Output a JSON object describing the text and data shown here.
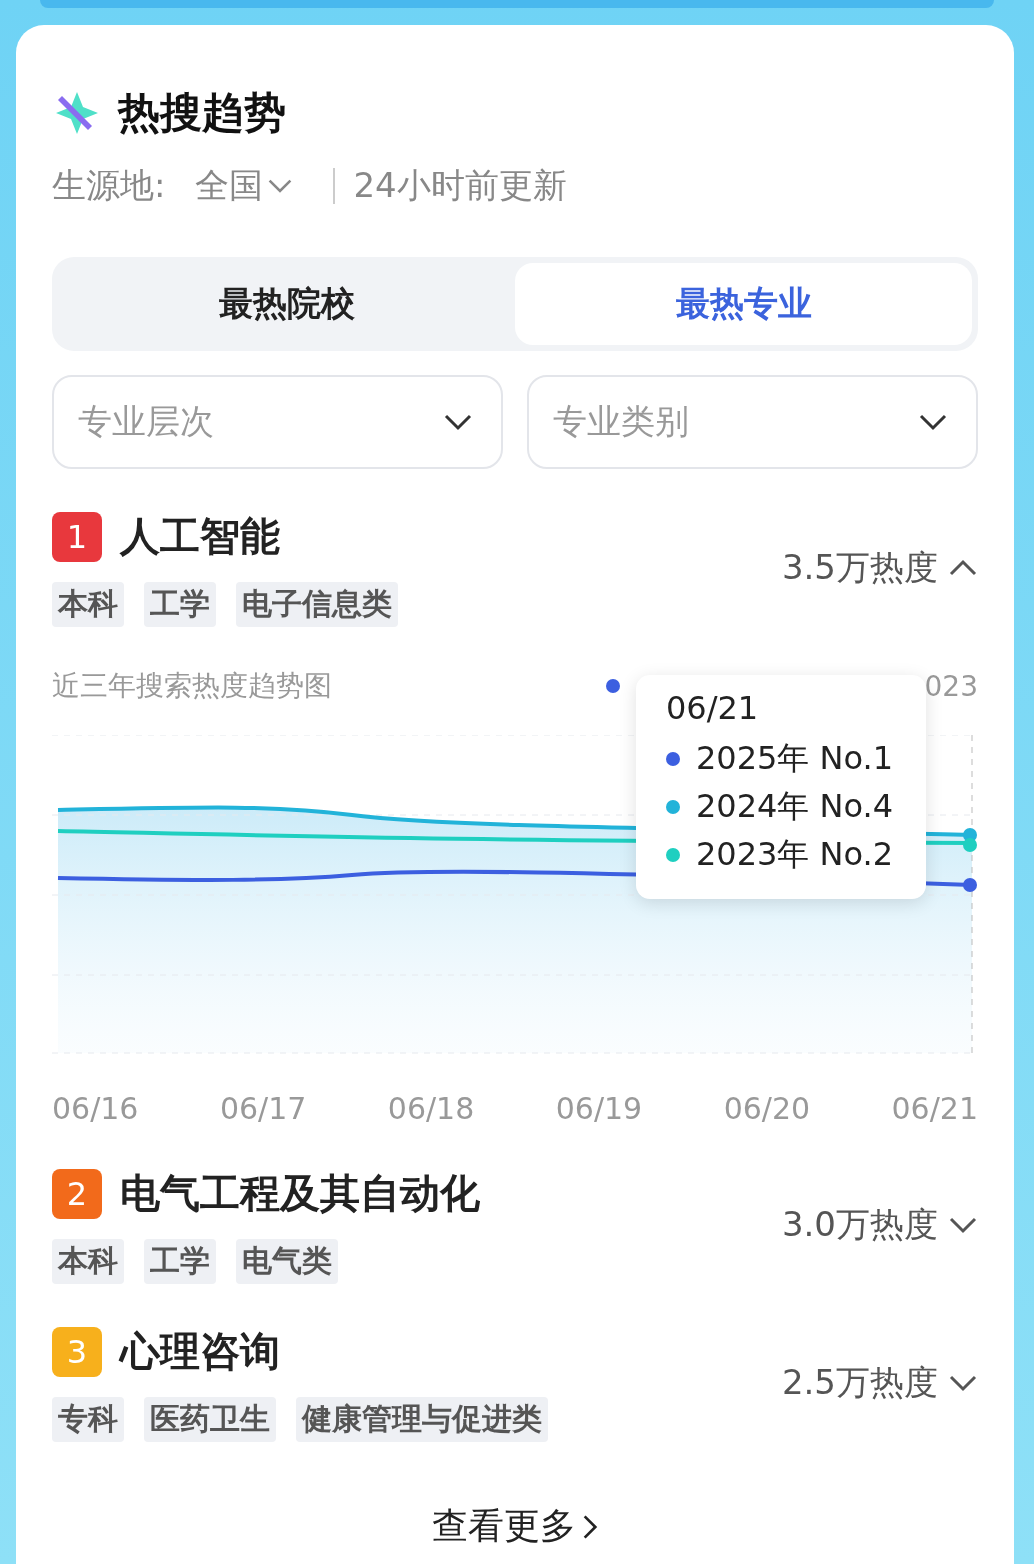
{
  "header": {
    "title": "热搜趋势",
    "origin_label": "生源地:",
    "origin_value": "全国",
    "updated": "24小时前更新"
  },
  "tabs": [
    {
      "label": "最热院校",
      "selected": false
    },
    {
      "label": "最热专业",
      "selected": true
    }
  ],
  "filters": [
    {
      "placeholder": "专业层次"
    },
    {
      "placeholder": "专业类别"
    }
  ],
  "majors": [
    {
      "rank": "1",
      "color": "#e8383d",
      "name": "人工智能",
      "tags": [
        "本科",
        "工学",
        "电子信息类"
      ],
      "heat": "3.5万热度",
      "expanded": true,
      "chart": {
        "title": "近三年搜索热度趋势图",
        "legend": {
          "color": "#3c5fe0",
          "end_label": "023"
        },
        "x_labels": [
          "06/16",
          "06/17",
          "06/18",
          "06/19",
          "06/20",
          "06/21"
        ],
        "tooltip": {
          "title": "06/21",
          "rows": [
            {
              "color": "#3c5fe0",
              "text": "2025年 No.1"
            },
            {
              "color": "#22b3d9",
              "text": "2024年 No.4"
            },
            {
              "color": "#1fcfc0",
              "text": "2023年 No.2"
            }
          ]
        }
      }
    },
    {
      "rank": "2",
      "color": "#f26a1b",
      "name": "电气工程及其自动化",
      "tags": [
        "本科",
        "工学",
        "电气类"
      ],
      "heat": "3.0万热度",
      "expanded": false
    },
    {
      "rank": "3",
      "color": "#f7b01c",
      "name": "心理咨询",
      "tags": [
        "专科",
        "医药卫生",
        "健康管理与促进类"
      ],
      "heat": "2.5万热度",
      "expanded": false
    }
  ],
  "more_link": "查看更多"
}
